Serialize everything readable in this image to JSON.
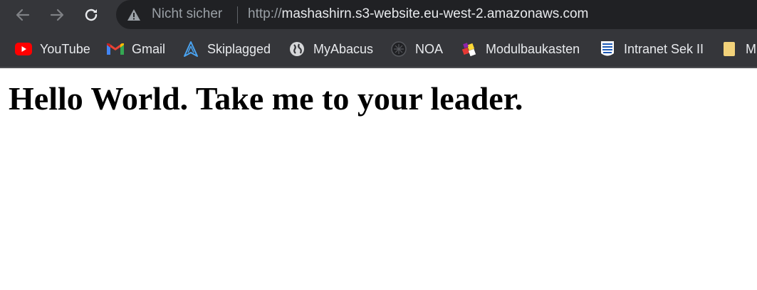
{
  "browser": {
    "security_label": "Nicht sicher",
    "url_scheme": "http://",
    "url_host": "mashashirn.s3-website.eu-west-2.amazonaws.com"
  },
  "bookmarks": [
    {
      "label": "YouTube",
      "icon": "youtube-icon"
    },
    {
      "label": "Gmail",
      "icon": "gmail-icon"
    },
    {
      "label": "Skiplagged",
      "icon": "skiplagged-icon"
    },
    {
      "label": "MyAbacus",
      "icon": "globe-icon"
    },
    {
      "label": "NOA",
      "icon": "noa-icon"
    },
    {
      "label": "Modulbaukasten",
      "icon": "modulbaukasten-icon"
    },
    {
      "label": "Intranet Sek II",
      "icon": "intranet-icon"
    },
    {
      "label": "M",
      "icon": "folder-icon"
    }
  ],
  "page": {
    "heading": "Hello World. Take me to your leader."
  },
  "colors": {
    "toolbar_bg": "#35363a",
    "omnibox_bg": "#202124",
    "youtube_red": "#ff0000"
  }
}
